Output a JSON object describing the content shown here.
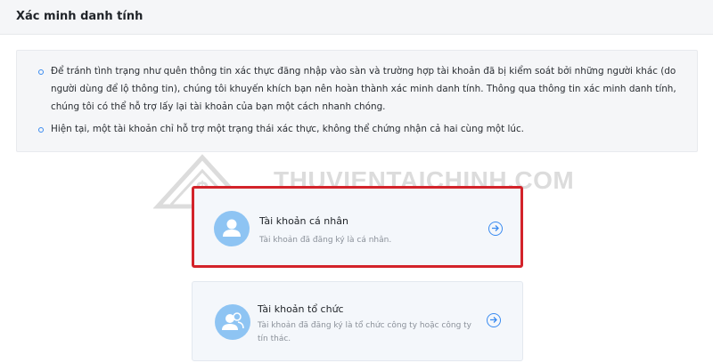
{
  "header": {
    "title": "Xác minh danh tính"
  },
  "notice": {
    "items": [
      "Để tránh tình trạng như quên thông tin xác thực đăng nhập vào sàn và trường hợp tài khoản đã bị kiểm soát bởi những người khác (do người dùng để lộ thông tin), chúng tôi khuyến khích bạn nên hoàn thành xác minh danh tính. Thông qua thông tin xác minh danh tính, chúng tôi có thể hỗ trợ lấy lại tài khoản của bạn một cách nhanh chóng.",
      "Hiện tại, một tài khoản chỉ hỗ trợ một trạng thái xác thực, không thể chứng nhận cả hai cùng một lúc."
    ]
  },
  "watermark": {
    "text": "THUVIENTAICHINH.COM"
  },
  "cards": [
    {
      "title": "Tài khoản cá nhân",
      "desc": "Tài khoản đã đăng ký là cá nhân.",
      "icon": "user-icon"
    },
    {
      "title": "Tài khoản tổ chức",
      "desc": "Tài khoản đã đăng ký là tổ chức công ty hoặc công ty tín thác.",
      "icon": "users-icon"
    }
  ],
  "colors": {
    "accent": "#3a8bf0",
    "highlight": "#d3232a",
    "avatar": "#8ec4f3"
  }
}
